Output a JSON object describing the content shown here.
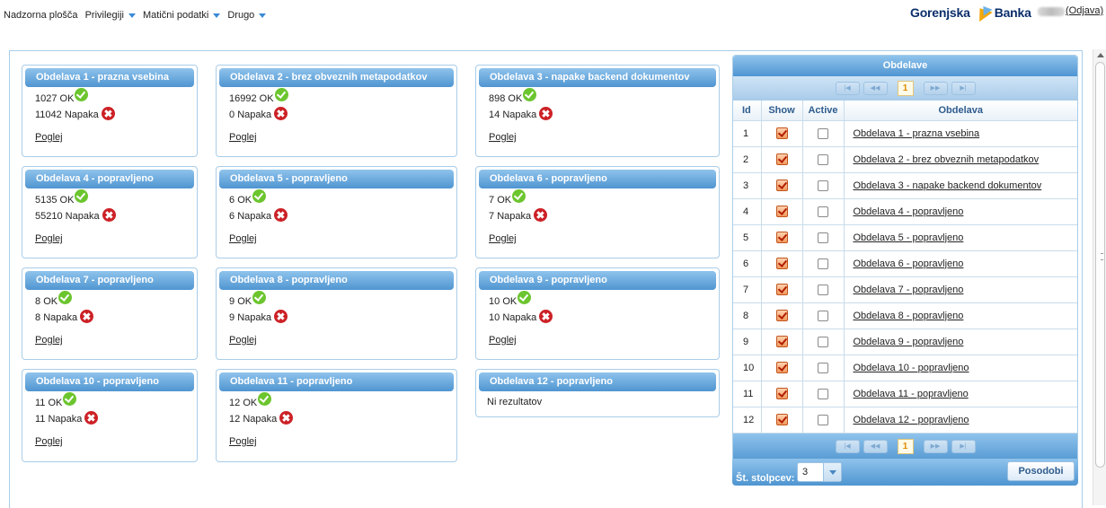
{
  "nav": {
    "items": [
      {
        "label": "Nadzorna plošča",
        "dropdown": false
      },
      {
        "label": "Privilegiji",
        "dropdown": true
      },
      {
        "label": "Matični podatki",
        "dropdown": true
      },
      {
        "label": "Drugo",
        "dropdown": true
      }
    ],
    "brand_left": "Gorenjska",
    "brand_right": "Banka",
    "logout": "(Odjava)"
  },
  "ok_suffix": "OK",
  "err_suffix": "Napaka",
  "view_label": "Poglej",
  "cards": [
    {
      "title": "Obdelava 1 - prazna vsebina",
      "ok": "1027",
      "errors": "11042"
    },
    {
      "title": "Obdelava 2 - brez obveznih metapodatkov",
      "ok": "16992",
      "errors": "0"
    },
    {
      "title": "Obdelava 3 - napake backend dokumentov",
      "ok": "898",
      "errors": "14"
    },
    {
      "title": "Obdelava 4 - popravljeno",
      "ok": "5135",
      "errors": "55210"
    },
    {
      "title": "Obdelava 5 - popravljeno",
      "ok": "6",
      "errors": "6"
    },
    {
      "title": "Obdelava 6 - popravljeno",
      "ok": "7",
      "errors": "7"
    },
    {
      "title": "Obdelava 7 - popravljeno",
      "ok": "8",
      "errors": "8"
    },
    {
      "title": "Obdelava 8 - popravljeno",
      "ok": "9",
      "errors": "9"
    },
    {
      "title": "Obdelava 9 - popravljeno",
      "ok": "10",
      "errors": "10"
    },
    {
      "title": "Obdelava 10 - popravljeno",
      "ok": "11",
      "errors": "11"
    },
    {
      "title": "Obdelava 11 - popravljeno",
      "ok": "12",
      "errors": "12"
    },
    {
      "title": "Obdelava 12 - popravljeno",
      "no_results": "Ni rezultatov"
    }
  ],
  "panel": {
    "title": "Obdelave",
    "current_page": "1",
    "pager_glyphs": {
      "first": "|◀",
      "prev": "◀◀",
      "next": "▶▶",
      "last": "▶|"
    },
    "columns": {
      "id": "Id",
      "show": "Show",
      "active": "Active",
      "name": "Obdelava"
    },
    "rows": [
      {
        "id": "1",
        "show": true,
        "active": false,
        "name": "Obdelava 1 - prazna vsebina"
      },
      {
        "id": "2",
        "show": true,
        "active": false,
        "name": "Obdelava 2 - brez obveznih metapodatkov"
      },
      {
        "id": "3",
        "show": true,
        "active": false,
        "name": "Obdelava 3 - napake backend dokumentov"
      },
      {
        "id": "4",
        "show": true,
        "active": false,
        "name": "Obdelava 4 - popravljeno"
      },
      {
        "id": "5",
        "show": true,
        "active": false,
        "name": "Obdelava 5 - popravljeno"
      },
      {
        "id": "6",
        "show": true,
        "active": false,
        "name": "Obdelava 6 - popravljeno"
      },
      {
        "id": "7",
        "show": true,
        "active": false,
        "name": "Obdelava 7 - popravljeno"
      },
      {
        "id": "8",
        "show": true,
        "active": false,
        "name": "Obdelava 8 - popravljeno"
      },
      {
        "id": "9",
        "show": true,
        "active": false,
        "name": "Obdelava 9 - popravljeno"
      },
      {
        "id": "10",
        "show": true,
        "active": false,
        "name": "Obdelava 10 - popravljeno"
      },
      {
        "id": "11",
        "show": true,
        "active": false,
        "name": "Obdelava 11 - popravljeno"
      },
      {
        "id": "12",
        "show": true,
        "active": false,
        "name": "Obdelava 12 - popravljeno"
      }
    ],
    "columns_label": "Št. stolpcev:",
    "columns_value": "3",
    "update_label": "Posodobi"
  },
  "colors": {
    "header_top": "#8fc3ec",
    "header_bottom": "#4f95d1",
    "border": "#a9cde8",
    "ok": "#6cc52e",
    "error": "#cc2126",
    "brand": "#0b2e6b"
  }
}
